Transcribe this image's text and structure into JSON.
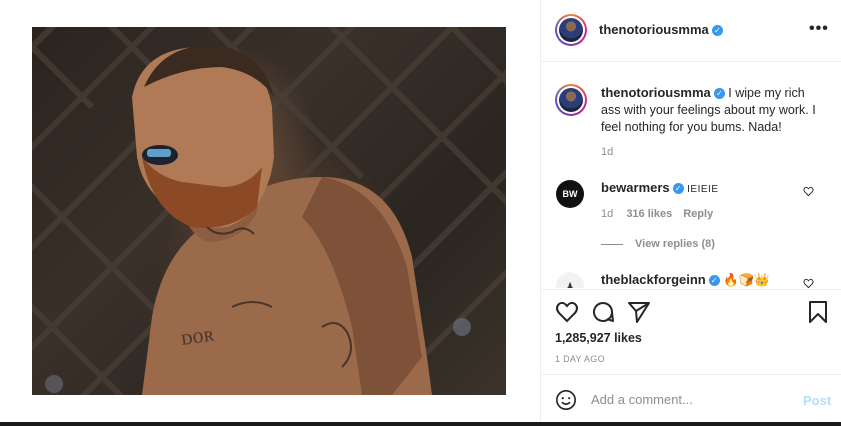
{
  "post": {
    "author": "thenotoriousmma",
    "more_icon": "•••",
    "caption_author": "thenotoriousmma",
    "caption_text": "I wipe my rich ass with your feelings about my work. I feel nothing for you bums. Nada!",
    "caption_time": "1d",
    "verified_glyph": "✓"
  },
  "comments": [
    {
      "avatar_text": "BW",
      "username": "bewarmers",
      "text": "IEIEIE",
      "time": "1d",
      "likes": "316 likes",
      "reply": "Reply",
      "view_replies": "View replies (8)"
    },
    {
      "username": "theblackforgeinn",
      "text": "🔥🍞👑"
    }
  ],
  "actions": {
    "likes": "1,285,927 likes",
    "date": "1 DAY AGO"
  },
  "comment_box": {
    "placeholder": "Add a comment...",
    "post_label": "Post"
  },
  "colors": {
    "verified": "#3897f0",
    "post_button_disabled": "#b2dffc",
    "muted": "#8e8e8e"
  }
}
